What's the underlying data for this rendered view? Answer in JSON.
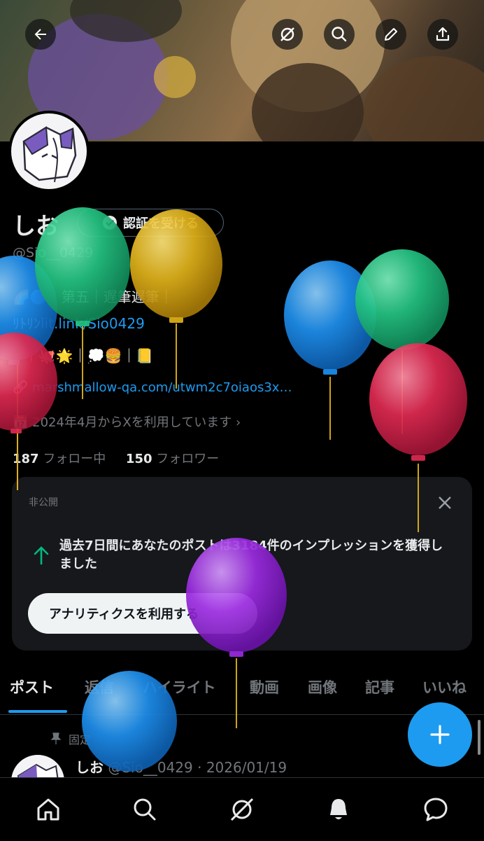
{
  "header": {
    "back_icon": "back-arrow-icon",
    "buttons": [
      "grok-icon",
      "search-icon",
      "edit-icon",
      "share-icon"
    ]
  },
  "profile": {
    "name": "しお",
    "verify_label": "認証を受ける",
    "handle": "@Sio__0429",
    "bio_line1": "🌈🔵｜第五｜遅筆遅筆｜",
    "bio_line2_prefix": "ﾘﾄﾘﾝ",
    "bio_line2_link": "lit.link/Sio0429",
    "bio_line3": "✕｜🐙🌟｜💭🍔｜📒",
    "website": "marshmallow-qa.com/utwm2c7oiaos3x…",
    "joined": "2024年4月からXを利用しています",
    "following_count": "187",
    "following_label": "フォロー中",
    "followers_count": "150",
    "followers_label": "フォロワー"
  },
  "analytics_card": {
    "label": "非公開",
    "text": "過去7日間にあなたのポストは3184件のインプレッションを獲得しました",
    "button": "アナリティクスを利用する"
  },
  "tabs": [
    "ポスト",
    "返信",
    "ハイライト",
    "動画",
    "画像",
    "記事",
    "いいね"
  ],
  "pinned_post": {
    "pinned_label": "固定",
    "author": "しお",
    "meta": "@Sio__0429 · 2026/01/19"
  },
  "bottom_nav": [
    "home-icon",
    "search-icon",
    "grok-icon",
    "notifications-icon",
    "messages-icon"
  ],
  "colors": {
    "accent": "#1d9bf0",
    "background": "#000000",
    "card": "#16181c",
    "muted": "#71767b"
  }
}
